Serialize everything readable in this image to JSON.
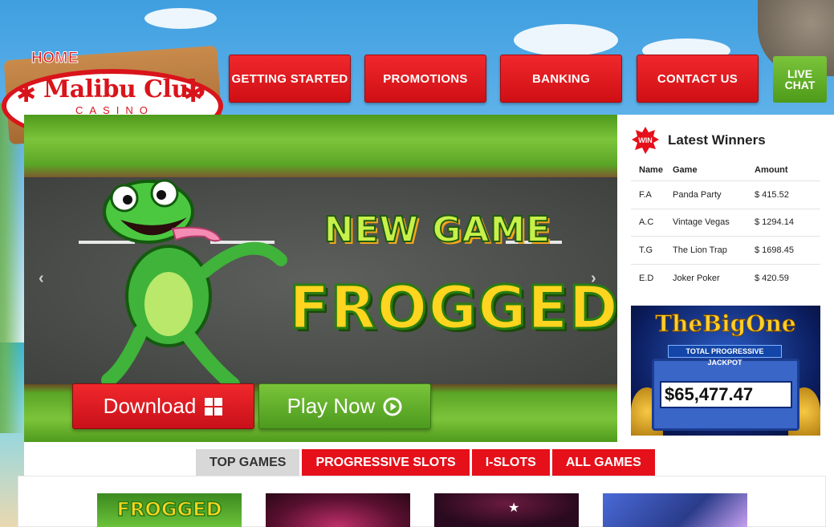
{
  "logo": {
    "home": "HOME",
    "brand": "Malibu Club",
    "sub": "CASINO"
  },
  "nav": {
    "items": [
      {
        "label": "GETTING STARTED"
      },
      {
        "label": "PROMOTIONS"
      },
      {
        "label": "BANKING"
      },
      {
        "label": "CONTACT US"
      }
    ],
    "live_chat": [
      "LIVE",
      "CHAT"
    ]
  },
  "hero": {
    "line1": "NEW GAME",
    "line2": "FROGGED",
    "download_label": "Download",
    "play_label": "Play Now"
  },
  "winners": {
    "badge": "WIN",
    "title": "Latest Winners",
    "columns": [
      "Name",
      "Game",
      "Amount"
    ],
    "rows": [
      {
        "name": "F.A",
        "game": "Panda Party",
        "amount": "$ 415.52"
      },
      {
        "name": "A.C",
        "game": "Vintage Vegas",
        "amount": "$ 1294.14"
      },
      {
        "name": "T.G",
        "game": "The Lion Trap",
        "amount": "$ 1698.45"
      },
      {
        "name": "E.D",
        "game": "Joker Poker",
        "amount": "$ 420.59"
      }
    ]
  },
  "jackpot": {
    "title": "TheBigOne",
    "label": "TOTAL PROGRESSIVE JACKPOT",
    "amount": "$65,477.47"
  },
  "tabs": [
    {
      "label": "TOP GAMES",
      "active": true
    },
    {
      "label": "PROGRESSIVE SLOTS",
      "active": false
    },
    {
      "label": "I-SLOTS",
      "active": false
    },
    {
      "label": "ALL GAMES",
      "active": false
    }
  ],
  "games": [
    {
      "title": "FROGGED",
      "color": "#3b8a1f"
    },
    {
      "title": "",
      "color": "#5a1030"
    },
    {
      "title": "",
      "color": "#2a0a1e"
    },
    {
      "title": "",
      "color": "#2a3c8a"
    }
  ],
  "colors": {
    "red": "#e5101a",
    "green": "#5aa526",
    "tab_active": "#d8d8d8"
  }
}
